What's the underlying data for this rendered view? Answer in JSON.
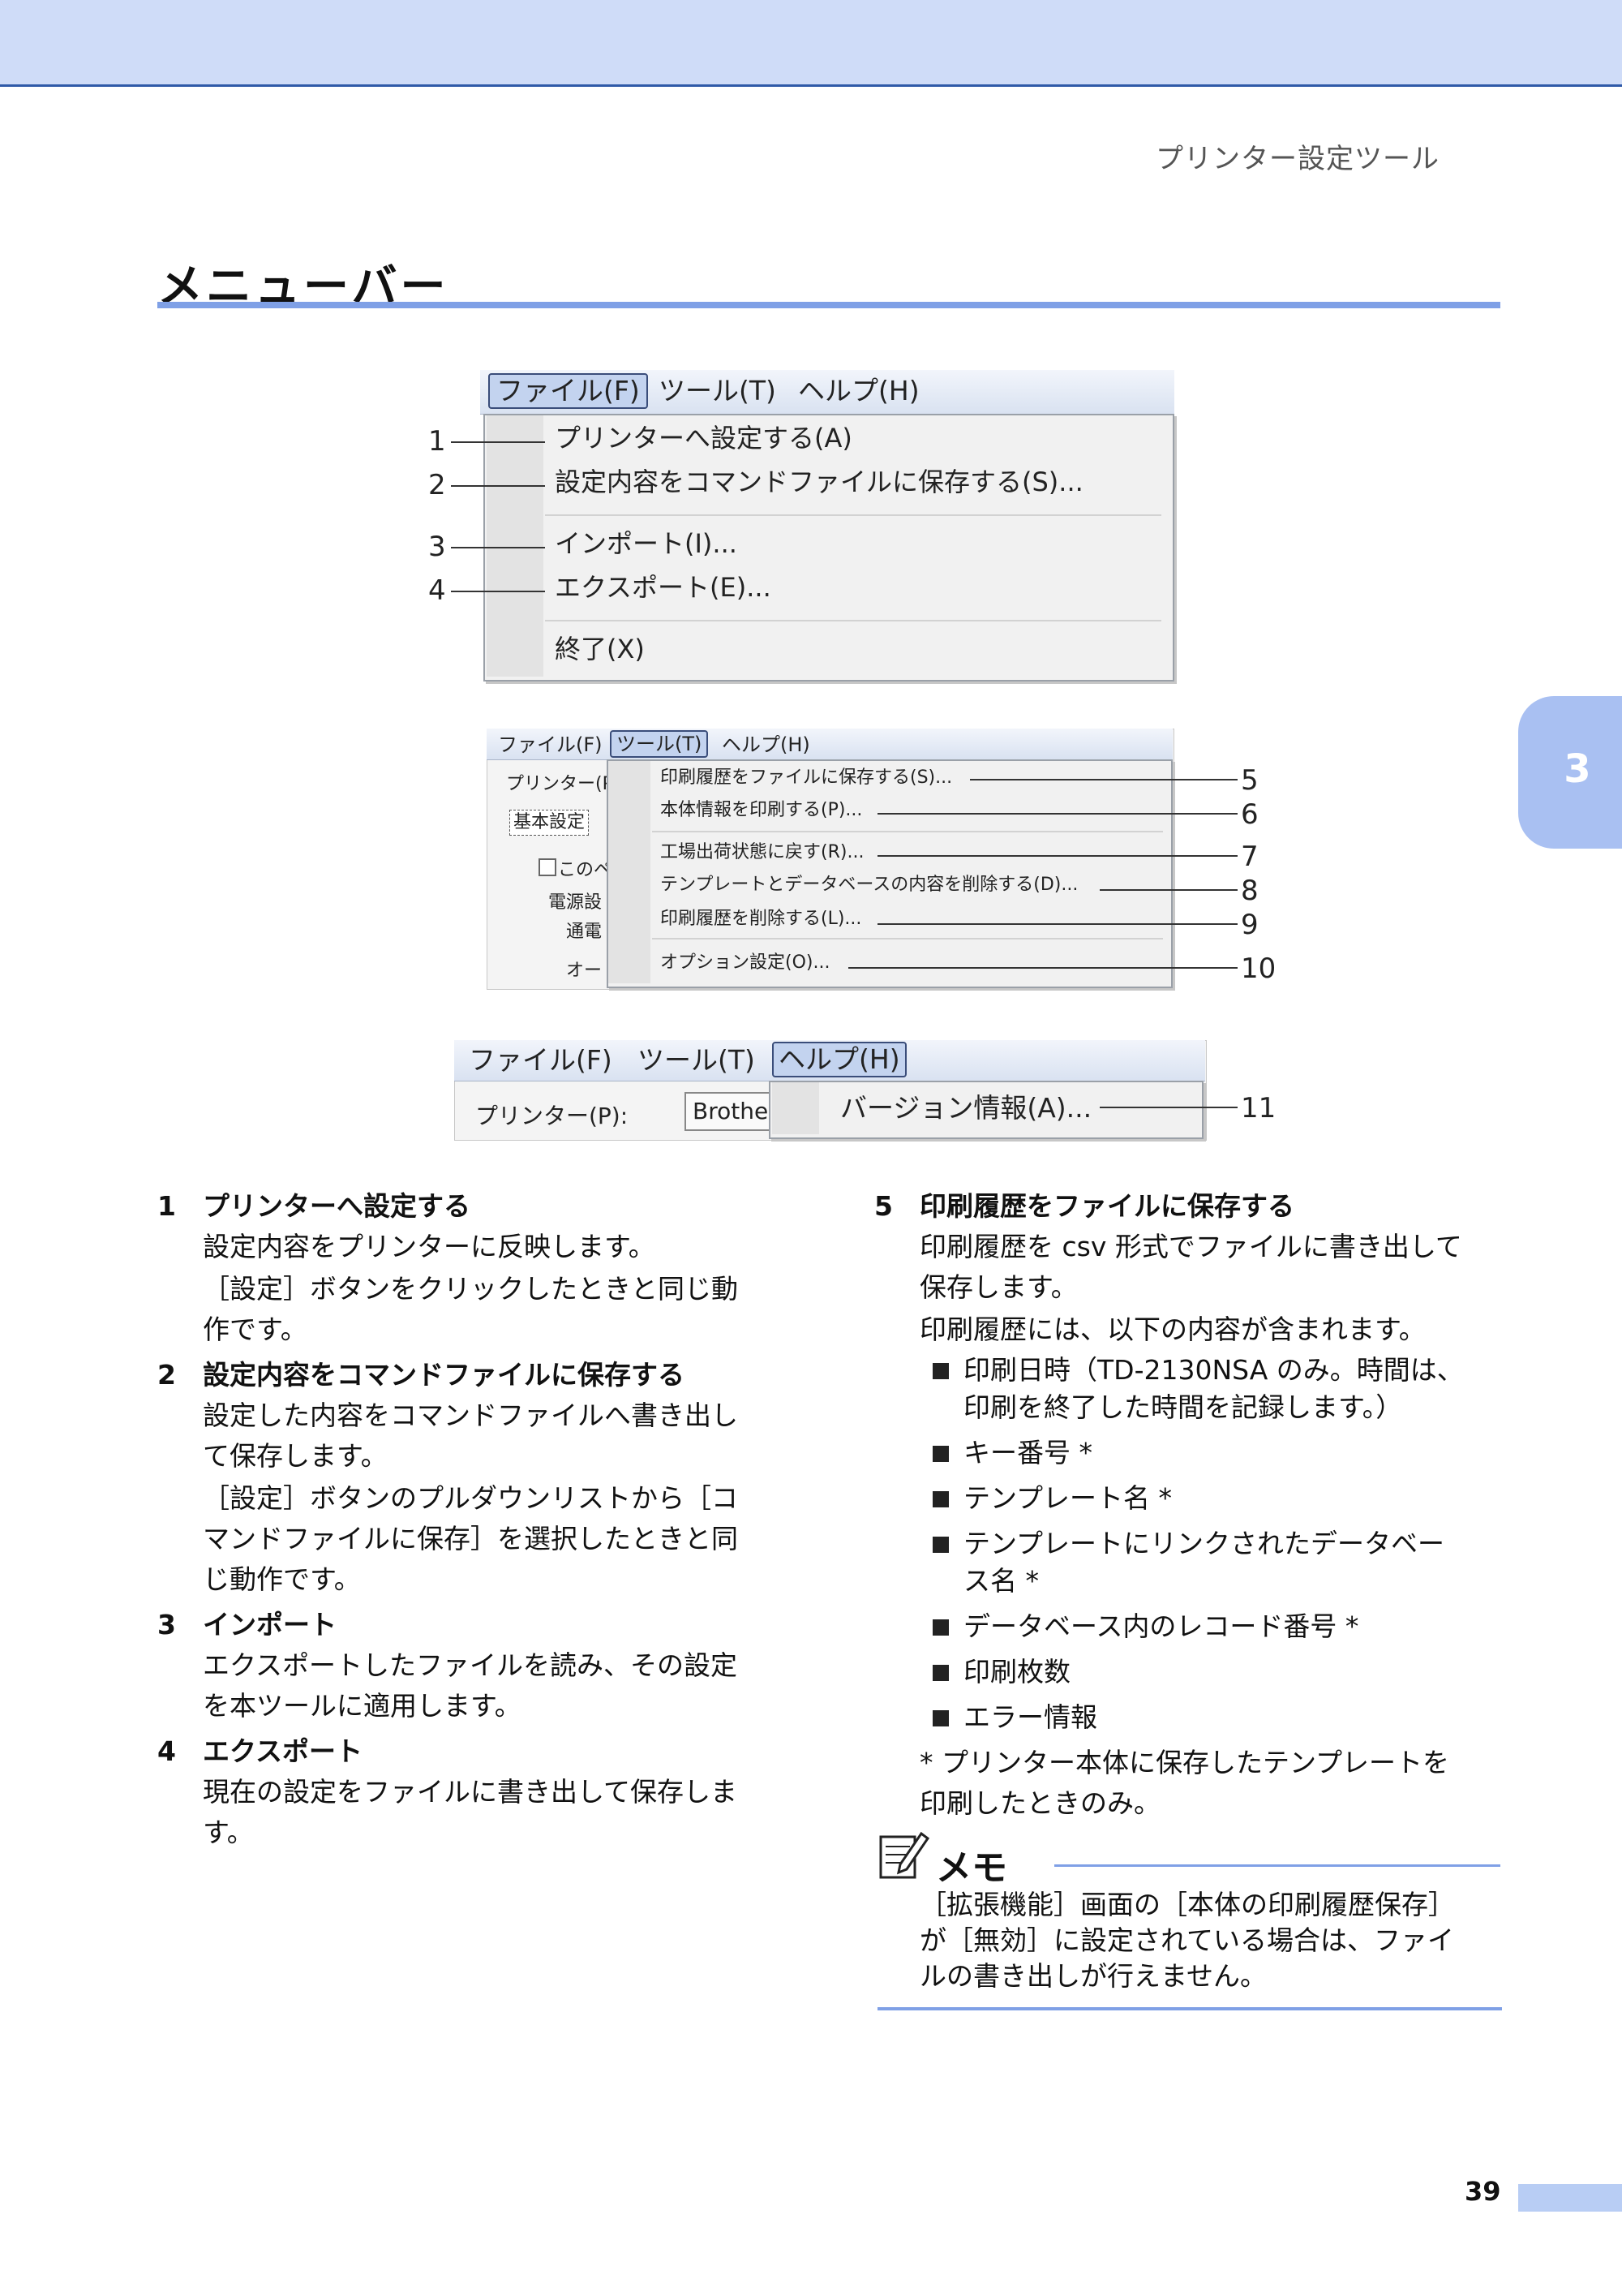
{
  "header": {
    "running_title": "プリンター設定ツール"
  },
  "section": {
    "title": "メニューバー"
  },
  "chapter_tab": {
    "number": "3"
  },
  "screenshots": {
    "file_menu": {
      "menubar": [
        "ファイル(F)",
        "ツール(T)",
        "ヘルプ(H)"
      ],
      "items": [
        {
          "label": "プリンターへ設定する(A)",
          "callout": "1"
        },
        {
          "label": "設定内容をコマンドファイルに保存する(S)...",
          "callout": "2"
        },
        {
          "label": "インポート(I)...",
          "callout": "3"
        },
        {
          "label": "エクスポート(E)...",
          "callout": "4"
        },
        {
          "label": "終了(X)"
        }
      ]
    },
    "tool_menu": {
      "menubar": [
        "ファイル(F)",
        "ツール(T)",
        "ヘルプ(H)"
      ],
      "left_panel": {
        "printer_label": "プリンター(P):",
        "tab": "基本設定",
        "checkbox": "このペ",
        "group": "電源設",
        "row1": "通電",
        "row2": "オート"
      },
      "items": [
        {
          "label": "印刷履歴をファイルに保存する(S)...",
          "callout": "5"
        },
        {
          "label": "本体情報を印刷する(P)...",
          "callout": "6"
        },
        {
          "label": "工場出荷状態に戻す(R)...",
          "callout": "7"
        },
        {
          "label": "テンプレートとデータベースの内容を削除する(D)...",
          "callout": "8"
        },
        {
          "label": "印刷履歴を削除する(L)...",
          "callout": "9"
        },
        {
          "label": "オプション設定(O)...",
          "callout": "10"
        }
      ]
    },
    "help_menu": {
      "menubar": [
        "ファイル(F)",
        "ツール(T)",
        "ヘルプ(H)"
      ],
      "printer_label": "プリンター(P):",
      "printer_value": "Brother",
      "items": [
        {
          "label": "バージョン情報(A)...",
          "callout": "11"
        }
      ]
    }
  },
  "items_left": [
    {
      "num": "1",
      "title": "プリンターへ設定する",
      "paras": [
        "設定内容をプリンターに反映します。",
        "［設定］ボタンをクリックしたときと同じ動",
        "作です。"
      ]
    },
    {
      "num": "2",
      "title": "設定内容をコマンドファイルに保存する",
      "paras": [
        "設定した内容をコマンドファイルへ書き出し",
        "て保存します。",
        "［設定］ボタンのプルダウンリストから［コ",
        "マンドファイルに保存］を選択したときと同",
        "じ動作です。"
      ]
    },
    {
      "num": "3",
      "title": "インポート",
      "paras": [
        "エクスポートしたファイルを読み、その設定",
        "を本ツールに適用します。"
      ]
    },
    {
      "num": "4",
      "title": "エクスポート",
      "paras": [
        "現在の設定をファイルに書き出して保存しま",
        "す。"
      ]
    }
  ],
  "items_right": {
    "num": "5",
    "title": "印刷履歴をファイルに保存する",
    "paras": [
      "印刷履歴を csv 形式でファイルに書き出して",
      "保存します。",
      "印刷履歴には、以下の内容が含まれます。"
    ],
    "bullets": [
      [
        "印刷日時（TD-2130NSA のみ。時間は、",
        "印刷を終了した時間を記録します。）"
      ],
      [
        "キー番号 *"
      ],
      [
        "テンプレート名 *"
      ],
      [
        "テンプレートにリンクされたデータベー",
        "ス名 *"
      ],
      [
        "データベース内のレコード番号 *"
      ],
      [
        "印刷枚数"
      ],
      [
        "エラー情報"
      ]
    ],
    "footnote": [
      "* プリンター本体に保存したテンプレートを",
      "印刷したときのみ。"
    ]
  },
  "memo": {
    "label": "メモ",
    "lines": [
      "［拡張機能］画面の［本体の印刷履歴保存］",
      "が［無効］に設定されている場合は、ファイ",
      "ルの書き出しが行えません。"
    ]
  },
  "footer": {
    "page_number": "39"
  }
}
